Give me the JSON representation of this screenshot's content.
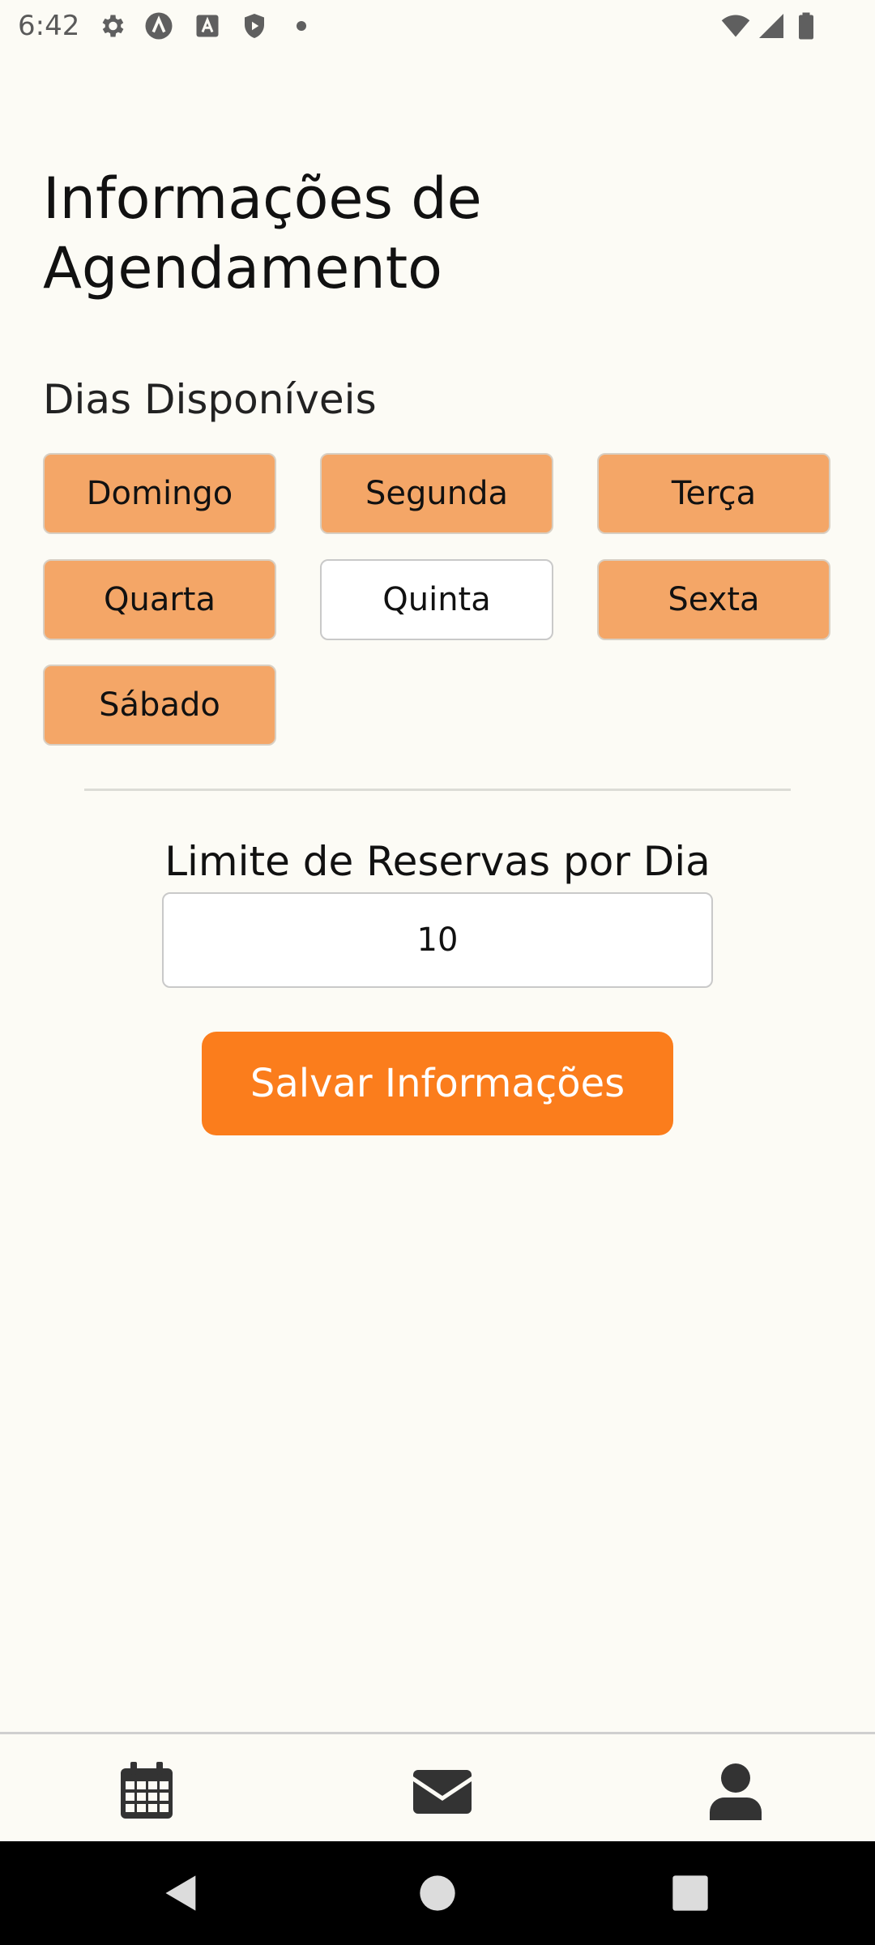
{
  "status_bar": {
    "time": "6:42",
    "icons": [
      "gear-icon",
      "a-circle-icon",
      "a-square-icon",
      "shield-play-icon",
      "dot-icon"
    ],
    "right_icons": [
      "wifi-icon",
      "signal-icon",
      "battery-icon"
    ]
  },
  "header": {
    "title": "Informações de Agendamento"
  },
  "days_section": {
    "label": "Dias Disponíveis",
    "days": [
      {
        "label": "Domingo",
        "selected": true
      },
      {
        "label": "Segunda",
        "selected": true
      },
      {
        "label": "Terça",
        "selected": true
      },
      {
        "label": "Quarta",
        "selected": true
      },
      {
        "label": "Quinta",
        "selected": false
      },
      {
        "label": "Sexta",
        "selected": true
      },
      {
        "label": "Sábado",
        "selected": true
      }
    ]
  },
  "limit_section": {
    "label": "Limite de Reservas por Dia",
    "value": "10"
  },
  "actions": {
    "save_label": "Salvar Informações"
  },
  "tab_bar": {
    "tabs": [
      "calendar-icon",
      "envelope-icon",
      "user-icon"
    ]
  },
  "nav_bar": {
    "buttons": [
      "back-icon",
      "home-icon",
      "recents-icon"
    ]
  },
  "colors": {
    "background": "#fcfbf5",
    "day_selected": "#f4a667",
    "day_unselected": "#ffffff",
    "primary_button": "#fb7d1c"
  }
}
